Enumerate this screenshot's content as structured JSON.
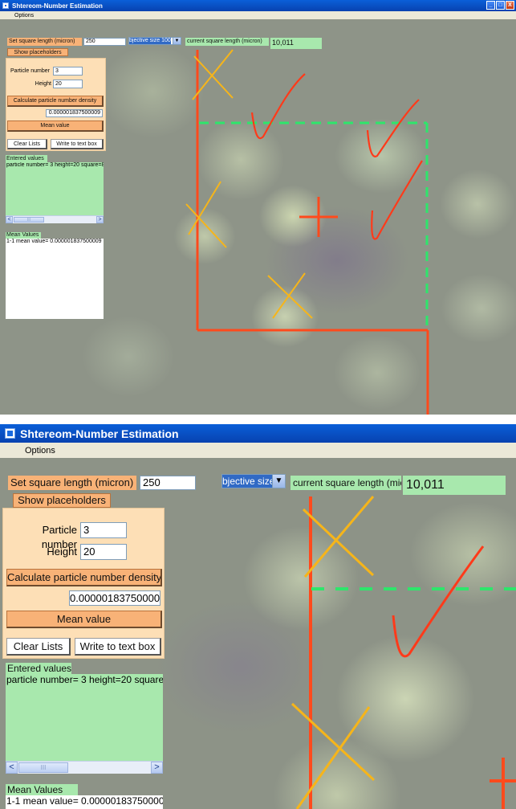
{
  "window": {
    "title": "Shtereom-Number Estimation",
    "menu": [
      "Options"
    ],
    "buttons": [
      "_",
      "□",
      "X"
    ]
  },
  "toolbar": {
    "set_square_label": "Set square length (micron)",
    "square_length_value": "250",
    "objective_size_value": "bjective size 100",
    "objective_arrow": "▼",
    "current_square_label": "current square length (micron)",
    "current_square_value": "10,011",
    "show_placeholders_label": "Show placeholders"
  },
  "form": {
    "particle_number_label": "Particle number",
    "particle_number_value": "3",
    "height_label": "Height",
    "height_value": "20",
    "calculate_label": "Calculate particle number density",
    "result_value": "0.000001837500009",
    "mean_value_label": "Mean value",
    "clear_lists_label": "Clear Lists",
    "write_to_text_box_label": "Write to text box"
  },
  "entered_values": {
    "label": "Entered values",
    "rows": [
      "particle number= 3 height=20 square=8"
    ],
    "scroll_left": "<",
    "scroll_grip": "III",
    "scroll_right": ">"
  },
  "mean_values": {
    "label": "Mean Values",
    "rows": [
      "1-1 mean value= 0.000001837500009"
    ]
  },
  "colors": {
    "titlebar": "#0a5fd8",
    "orange_button": "#f8b277",
    "green_label": "#a8e8ad",
    "panel": "#fddfb6",
    "grid_red": "#ff4a1c",
    "grid_green": "#2ee66b",
    "mark_yellow": "#f6b51a",
    "check_red": "#ff3a1a"
  },
  "markers": {
    "screenshot1": {
      "crosses": 4,
      "checks": 3,
      "center_plus": 1
    },
    "screenshot2": {
      "crosses": 2,
      "checks": 1,
      "center_plus": 1
    }
  }
}
